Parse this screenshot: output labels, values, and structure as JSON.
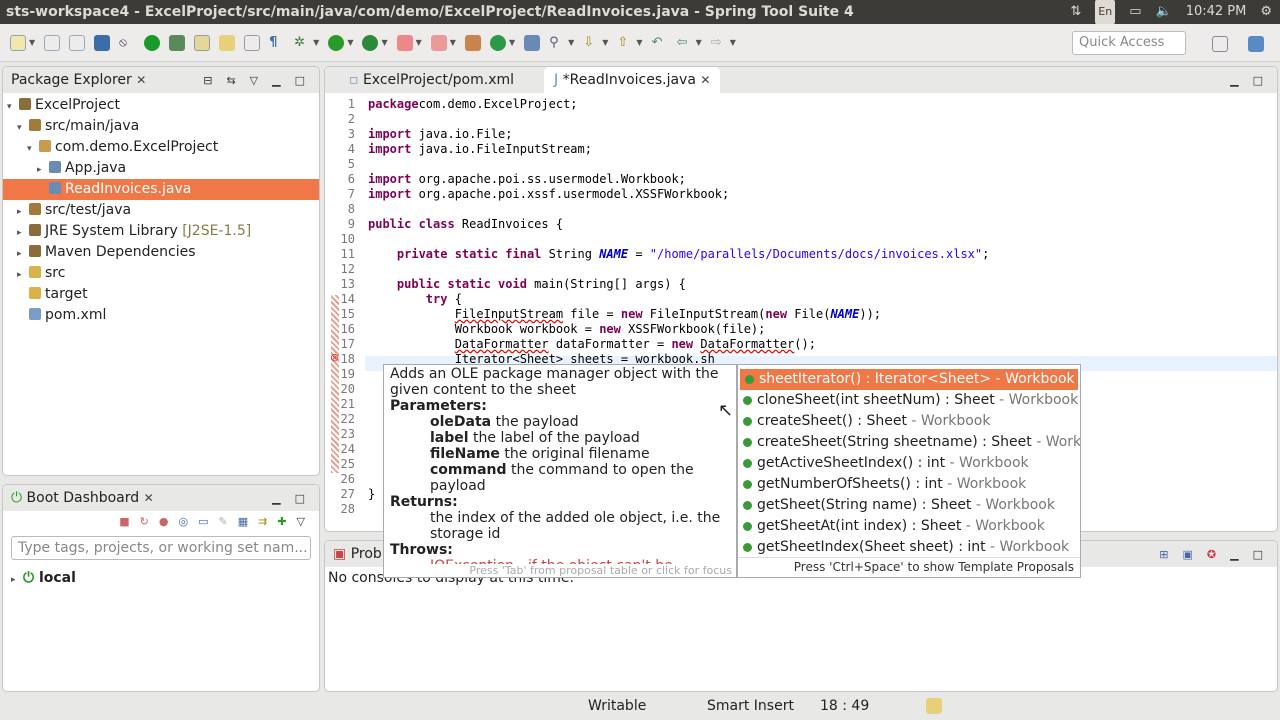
{
  "window": {
    "title": "sts-workspace4 - ExcelProject/src/main/java/com/demo/ExcelProject/ReadInvoices.java - Spring Tool Suite 4",
    "lang": "En",
    "clock": "10:42 PM"
  },
  "toolbar": {
    "quick_access_placeholder": "Quick Access"
  },
  "package_explorer": {
    "title": "Package Explorer",
    "tree": [
      {
        "label": "ExcelProject",
        "depth": 0,
        "arrow": "▾",
        "icon": "project-icon",
        "color": "#8a6d3b"
      },
      {
        "label": "src/main/java",
        "depth": 1,
        "arrow": "▾",
        "icon": "source-folder-icon",
        "color": "#a07b3a"
      },
      {
        "label": "com.demo.ExcelProject",
        "depth": 2,
        "arrow": "▾",
        "icon": "package-icon",
        "color": "#c89a4b"
      },
      {
        "label": "App.java",
        "depth": 3,
        "arrow": "▸",
        "icon": "java-file-icon",
        "color": "#6a8bb5"
      },
      {
        "label": "ReadInvoices.java",
        "depth": 3,
        "arrow": "",
        "icon": "java-file-icon",
        "color": "#6a8bb5",
        "selected": true
      },
      {
        "label": "src/test/java",
        "depth": 1,
        "arrow": "▸",
        "icon": "source-folder-icon",
        "color": "#a07b3a"
      },
      {
        "label": "JRE System Library",
        "suffix": " [J2SE-1.5]",
        "depth": 1,
        "arrow": "▸",
        "icon": "library-icon",
        "color": "#8a6d3b"
      },
      {
        "label": "Maven Dependencies",
        "depth": 1,
        "arrow": "▸",
        "icon": "library-icon",
        "color": "#8a6d3b"
      },
      {
        "label": "src",
        "depth": 1,
        "arrow": "▸",
        "icon": "folder-icon",
        "color": "#d9b24a"
      },
      {
        "label": "target",
        "depth": 1,
        "arrow": "",
        "icon": "folder-icon",
        "color": "#d9b24a"
      },
      {
        "label": "pom.xml",
        "depth": 1,
        "arrow": "",
        "icon": "xml-file-icon",
        "color": "#7a9cc6"
      }
    ]
  },
  "boot_dashboard": {
    "title": "Boot Dashboard",
    "filter_placeholder": "Type tags, projects, or working set nam...",
    "items": [
      {
        "label": "local"
      }
    ]
  },
  "editor": {
    "tabs": [
      {
        "label": "ExcelProject/pom.xml"
      },
      {
        "label": "*ReadInvoices.java",
        "active": true
      }
    ],
    "lines": [
      [
        [
          "kw",
          "package"
        ],
        [
          "",
          "com.demo.ExcelProject;"
        ]
      ],
      [],
      [
        [
          "kw",
          "import"
        ],
        [
          "",
          " java.io.File;"
        ]
      ],
      [
        [
          "kw",
          "import"
        ],
        [
          "",
          " java.io.FileInputStream;"
        ]
      ],
      [],
      [
        [
          "kw",
          "import"
        ],
        [
          "",
          " org.apache.poi.ss.usermodel.Workbook;"
        ]
      ],
      [
        [
          "kw",
          "import"
        ],
        [
          "",
          " org.apache.poi.xssf.usermodel.XSSFWorkbook;"
        ]
      ],
      [],
      [
        [
          "kw",
          "public class"
        ],
        [
          "",
          " ReadInvoices {"
        ]
      ],
      [],
      [
        [
          "",
          "    "
        ],
        [
          "kw",
          "private static final"
        ],
        [
          "",
          " String "
        ],
        [
          "fld",
          "NAME"
        ],
        [
          "",
          " = "
        ],
        [
          "str",
          "\"/home/parallels/Documents/docs/invoices.xlsx\""
        ],
        [
          "",
          ";"
        ]
      ],
      [],
      [
        [
          "",
          "    "
        ],
        [
          "kw",
          "public static void"
        ],
        [
          "",
          " main(String[] args) {"
        ]
      ],
      [
        [
          "",
          "        "
        ],
        [
          "kw",
          "try"
        ],
        [
          "",
          " {"
        ]
      ],
      [
        [
          "",
          "            "
        ],
        [
          "err",
          "FileInputStream"
        ],
        [
          "",
          " file = "
        ],
        [
          "kw",
          "new"
        ],
        [
          "",
          " FileInputStream("
        ],
        [
          "kw",
          "new"
        ],
        [
          "",
          " File("
        ],
        [
          "fld",
          "NAME"
        ],
        [
          "",
          "));"
        ]
      ],
      [
        [
          "",
          "            Workbook workbook = "
        ],
        [
          "kw",
          "new"
        ],
        [
          "",
          " XSSFWorkbook(file);"
        ]
      ],
      [
        [
          "",
          "            "
        ],
        [
          "err",
          "DataFormatter"
        ],
        [
          "",
          " dataFormatter = "
        ],
        [
          "kw",
          "new"
        ],
        [
          "",
          " "
        ],
        [
          "err",
          "DataFormatter"
        ],
        [
          "",
          "();"
        ]
      ],
      [
        [
          "",
          "            "
        ],
        [
          "err",
          "Iterator"
        ],
        [
          "",
          "<"
        ],
        [
          "err",
          "Sheet"
        ],
        [
          "",
          "> sheets = workbook.sh"
        ]
      ],
      [],
      [],
      [],
      [],
      [],
      [],
      [],
      [],
      [
        [
          "",
          "}"
        ]
      ],
      []
    ]
  },
  "javadoc": {
    "summary": "Adds an OLE package manager object with the given content to the sheet",
    "params_label": "Parameters:",
    "params": [
      {
        "name": "oleData",
        "desc": " the payload"
      },
      {
        "name": "label",
        "desc": " the label of the payload"
      },
      {
        "name": "fileName",
        "desc": " the original filename"
      },
      {
        "name": "command",
        "desc": " the command to open the payload"
      }
    ],
    "returns_label": "Returns:",
    "returns": "the index of the added ole object, i.e. the storage id",
    "throws_label": "Throws:",
    "throws": "IOException - if the object can't be",
    "hint": "Press 'Tab' from proposal table or click for focus"
  },
  "proposals": {
    "items": [
      {
        "name": "sheetIterator() : Iterator<Sheet>",
        "type": " - Workbook"
      },
      {
        "name": "cloneSheet(int sheetNum) : Sheet",
        "type": " - Workbook"
      },
      {
        "name": "createSheet() : Sheet",
        "type": " - Workbook"
      },
      {
        "name": "createSheet(String sheetname) : Sheet",
        "type": " - Workbook"
      },
      {
        "name": "getActiveSheetIndex() : int",
        "type": " - Workbook"
      },
      {
        "name": "getNumberOfSheets() : int",
        "type": " - Workbook"
      },
      {
        "name": "getSheet(String name) : Sheet",
        "type": " - Workbook"
      },
      {
        "name": "getSheetAt(int index) : Sheet",
        "type": " - Workbook"
      },
      {
        "name": "getSheetIndex(Sheet sheet) : int",
        "type": " - Workbook"
      }
    ],
    "hint": "Press 'Ctrl+Space' to show Template Proposals"
  },
  "console": {
    "tab": "Probl",
    "message": "No consoles to display at this time."
  },
  "status": {
    "writable": "Writable",
    "insert": "Smart Insert",
    "position": "18 : 49"
  }
}
